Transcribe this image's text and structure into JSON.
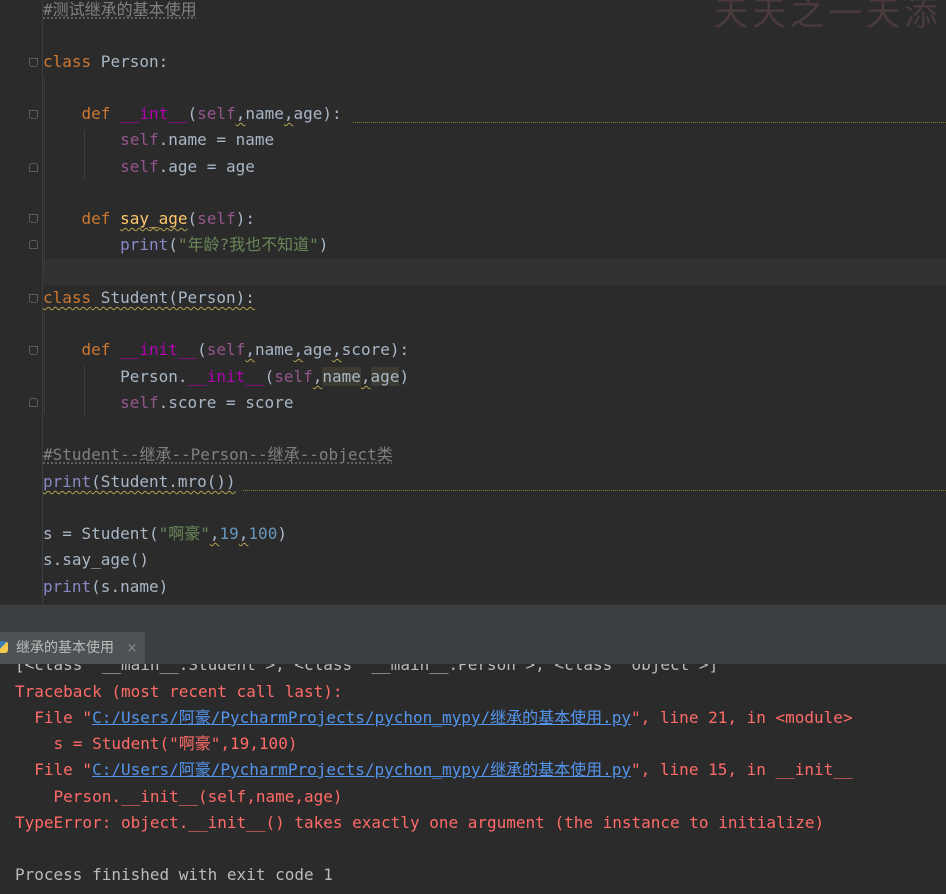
{
  "editor": {
    "watermark": "天天之一天添",
    "lines": {
      "l1": "#测试继承的基本使用",
      "l3_kw": "class",
      "l3_name": " Person:",
      "l5_def": "def",
      "l5_name": "__int__",
      "l5_open": "(",
      "l5_self": "self",
      "l5_comma1": ",",
      "l5_p1": "name",
      "l5_comma2": ",",
      "l5_p2": "age",
      "l5_close": "):",
      "l6_self": "self",
      "l6_rest": ".name = name",
      "l7_self": "self",
      "l7_rest": ".age = age",
      "l9_def": "def",
      "l9_name": "say_age",
      "l9_open": "(",
      "l9_self": "self",
      "l9_close": "):",
      "l10_print": "print",
      "l10_open": "(",
      "l10_str": "\"年龄?我也不知道\"",
      "l10_close": ")",
      "l12_kw": "class",
      "l12_name": " Student(Person):",
      "l14_def": "def",
      "l14_name": "__init__",
      "l14_open": "(",
      "l14_self": "self",
      "l14_c1": ",",
      "l14_p1": "name",
      "l14_c2": ",",
      "l14_p2": "age",
      "l14_c3": ",",
      "l14_p3": "score",
      "l14_close": "):",
      "l15_a": "Person.",
      "l15_init": "__init__",
      "l15_open": "(",
      "l15_self": "self",
      "l15_c1": ",",
      "l15_p1": "name",
      "l15_c2": ",",
      "l15_p2": "age",
      "l15_close": ")",
      "l16_self": "self",
      "l16_rest": ".score = score",
      "l18": "#Student--继承--Person--继承--object类",
      "l19_print": "print",
      "l19_rest": "(Student.mro())",
      "l21_a": "s = Student(",
      "l21_str": "\"啊豪\"",
      "l21_c1": ",",
      "l21_n1": "19",
      "l21_c2": ",",
      "l21_n2": "100",
      "l21_close": ")",
      "l22": "s.say_age()",
      "l23_print": "print",
      "l23_rest": "(s.name)"
    }
  },
  "run_tab": {
    "label": "继承的基本使用",
    "close": "×"
  },
  "console": {
    "cut_line": "[<class '__main__.Student'>, <class '__main__.Person'>, <class 'object'>]",
    "traceback": "Traceback (most recent call last):",
    "f1_pre": "  File \"",
    "f1_link": "C:/Users/阿豪/PycharmProjects/pychon_mypy/继承的基本使用.py",
    "f1_post": "\", line 21, in <module>",
    "f1_code": "    s = Student(\"啊豪\",19,100)",
    "f2_pre": "  File \"",
    "f2_link": "C:/Users/阿豪/PycharmProjects/pychon_mypy/继承的基本使用.py",
    "f2_post": "\", line 15, in __init__",
    "f2_code": "    Person.__init__(self,name,age)",
    "error": "TypeError: object.__init__() takes exactly one argument (the instance to initialize)",
    "exit": "Process finished with exit code 1"
  },
  "colors": {
    "background": "#2b2b2b",
    "keyword": "#cc7832",
    "string": "#6a8759",
    "error": "#ff6b68",
    "link": "#5394ec"
  }
}
